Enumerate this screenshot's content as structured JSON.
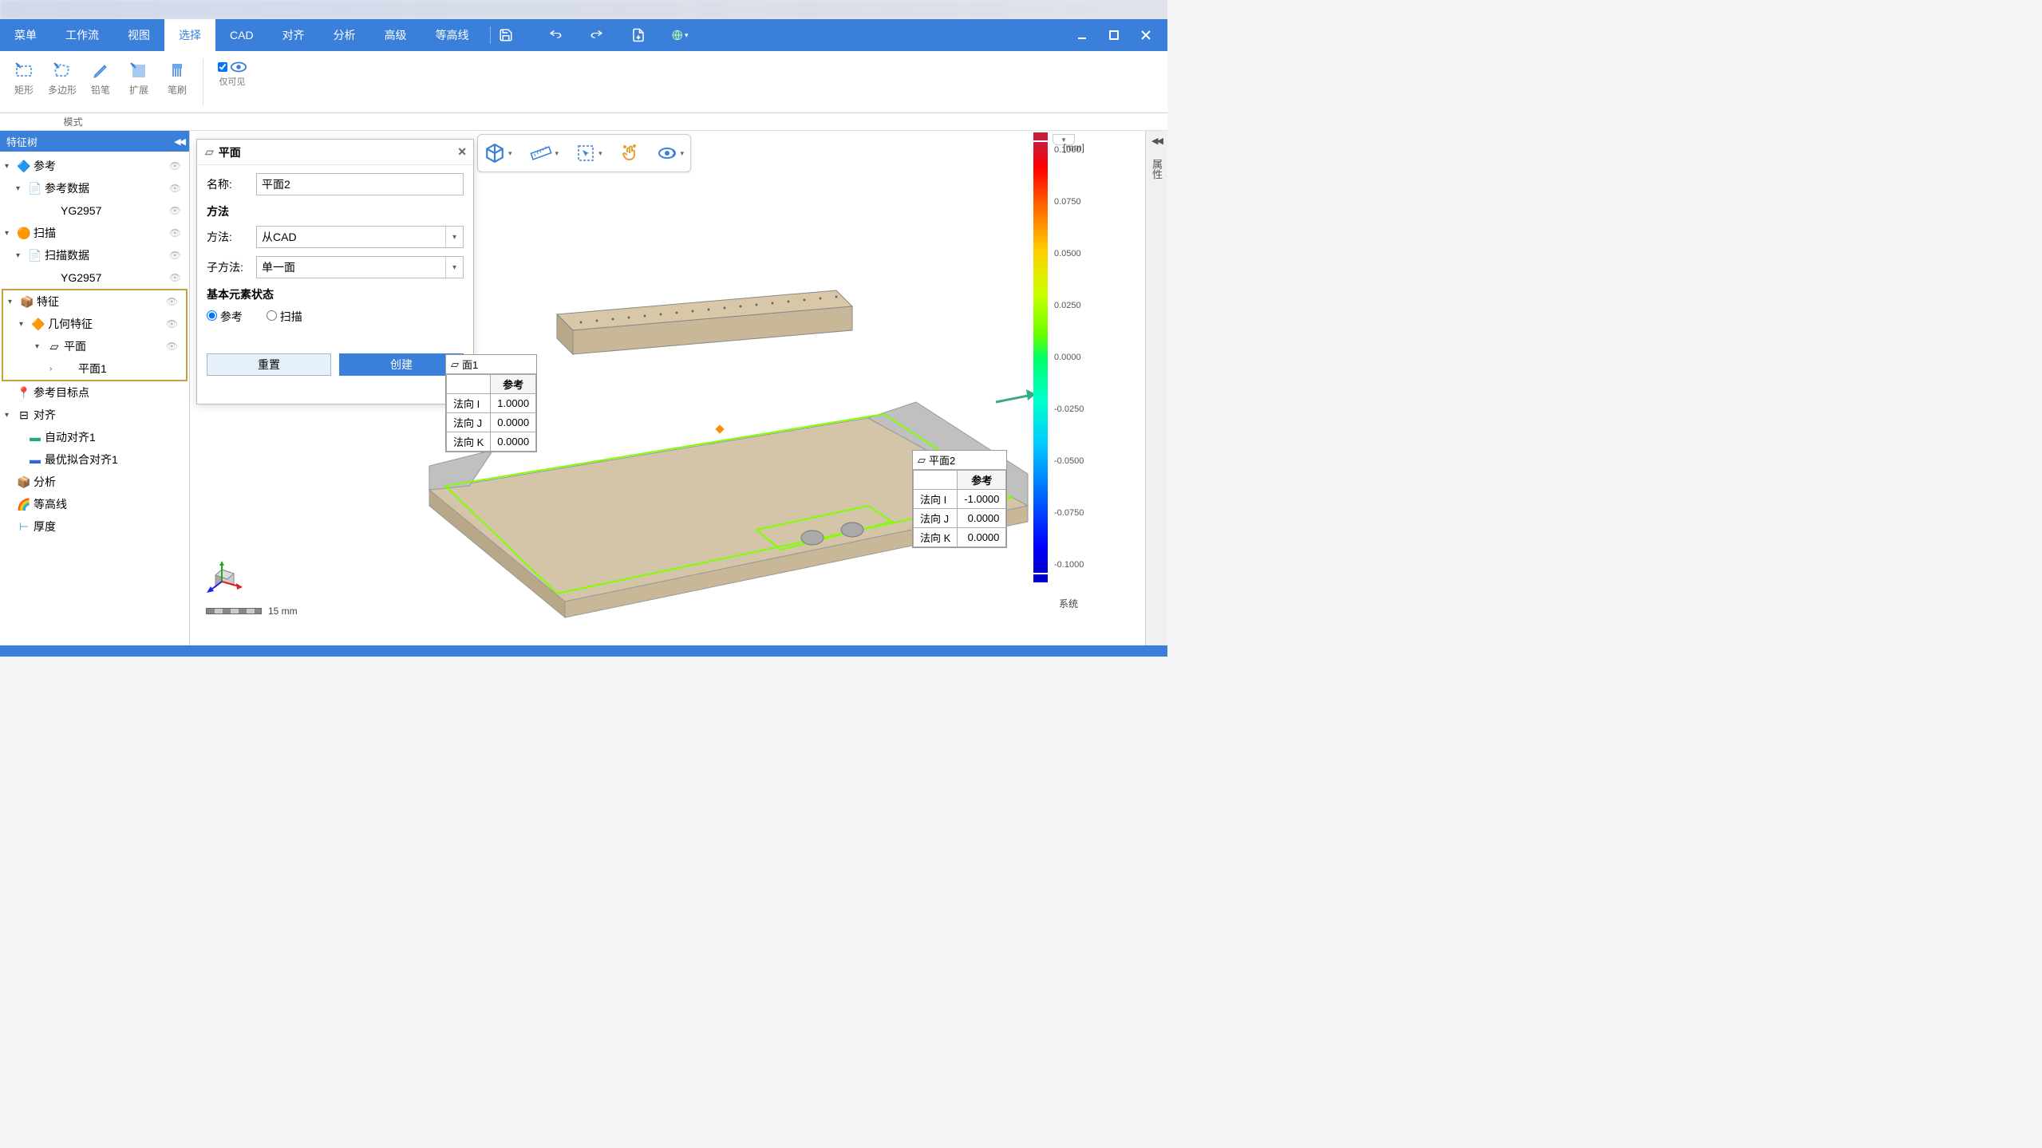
{
  "menubar": {
    "items": [
      "菜单",
      "工作流",
      "视图",
      "选择",
      "CAD",
      "对齐",
      "分析",
      "高级",
      "等高线"
    ],
    "active_index": 3
  },
  "ribbon": {
    "tools": [
      {
        "label": "矩形",
        "name": "rectangle-tool"
      },
      {
        "label": "多边形",
        "name": "polygon-tool"
      },
      {
        "label": "铅笔",
        "name": "pencil-tool"
      },
      {
        "label": "扩展",
        "name": "extend-tool"
      },
      {
        "label": "笔刷",
        "name": "brush-tool"
      }
    ],
    "visible_only": "仅可见",
    "group_label": "模式"
  },
  "sidebar": {
    "title": "特征树",
    "tree": {
      "ref": "参考",
      "ref_data": "参考数据",
      "ref_item": "YG2957",
      "scan": "扫描",
      "scan_data": "扫描数据",
      "scan_item": "YG2957",
      "feature": "特征",
      "geo_feature": "几何特征",
      "plane": "平面",
      "plane1": "平面1",
      "ref_target": "参考目标点",
      "align": "对齐",
      "auto_align": "自动对齐1",
      "best_fit": "最优拟合对齐1",
      "analysis": "分析",
      "contour": "等高线",
      "thickness": "厚度"
    }
  },
  "dialog": {
    "title": "平面",
    "name_label": "名称:",
    "name_value": "平面2",
    "method_section": "方法",
    "method_label": "方法:",
    "method_value": "从CAD",
    "submethod_label": "子方法:",
    "submethod_value": "单一面",
    "base_state": "基本元素状态",
    "radio_ref": "参考",
    "radio_scan": "扫描",
    "btn_reset": "重置",
    "btn_create": "创建"
  },
  "info1": {
    "title": "面1",
    "col": "参考",
    "rows": [
      {
        "label": "法向 I",
        "val": "1.0000"
      },
      {
        "label": "法向 J",
        "val": "0.0000"
      },
      {
        "label": "法向 K",
        "val": "0.0000"
      }
    ]
  },
  "info2": {
    "title": "平面2",
    "col": "参考",
    "rows": [
      {
        "label": "法向 I",
        "val": "-1.0000"
      },
      {
        "label": "法向 J",
        "val": "0.0000"
      },
      {
        "label": "法向 K",
        "val": "0.0000"
      }
    ]
  },
  "legend": {
    "unit": "[mm]",
    "values": [
      "0.1000",
      "0.0750",
      "0.0500",
      "0.0250",
      "0.0000",
      "-0.0250",
      "-0.0500",
      "-0.0750",
      "-0.1000"
    ],
    "system": "系统"
  },
  "right_panel": {
    "label": "属性"
  },
  "scale": {
    "label": "15 mm"
  }
}
